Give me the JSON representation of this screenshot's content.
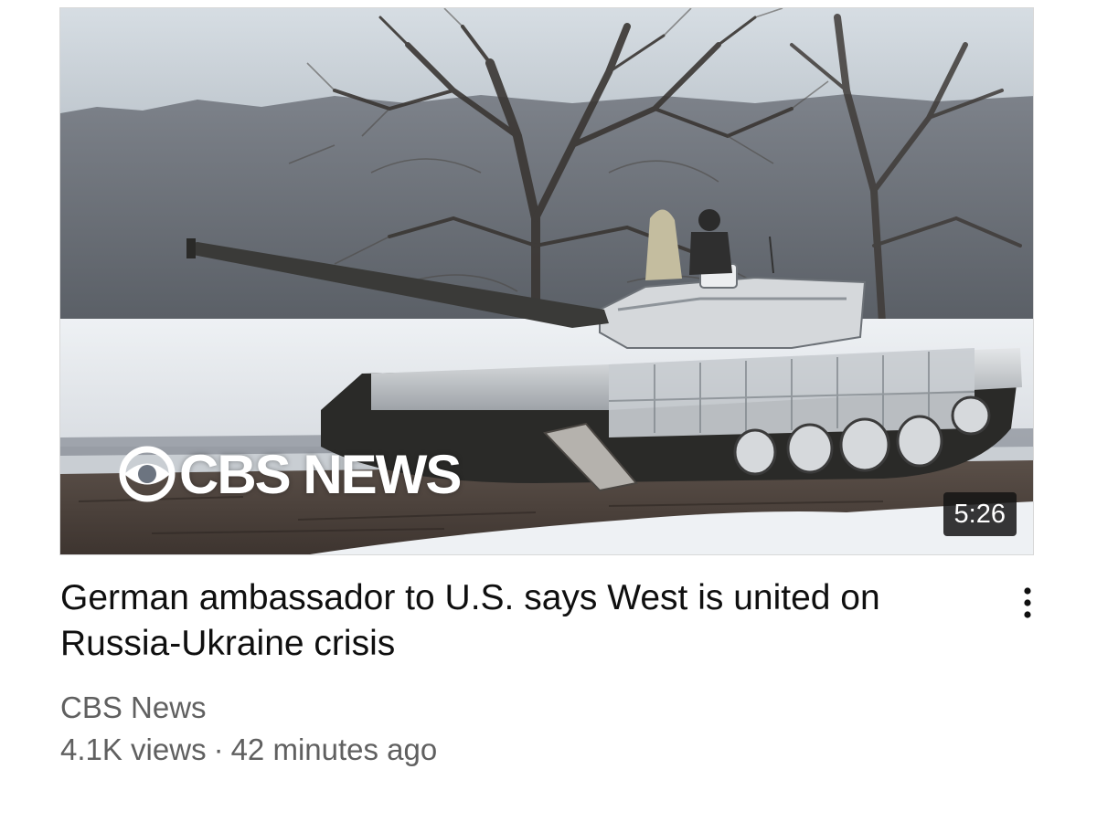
{
  "video": {
    "thumbnail_icon": "tank-in-snow-thumbnail",
    "watermark": "CBS NEWS",
    "duration": "5:26",
    "title": "German ambassador to U.S. says West is united on Russia-Ukraine crisis",
    "channel": "CBS News",
    "views": "4.1K views",
    "separator": "·",
    "age": "42 minutes ago",
    "menu_icon": "more-vert-icon"
  },
  "colors": {
    "title": "#0f0f0f",
    "secondary_text": "#606060",
    "duration_badge": "#141414"
  }
}
